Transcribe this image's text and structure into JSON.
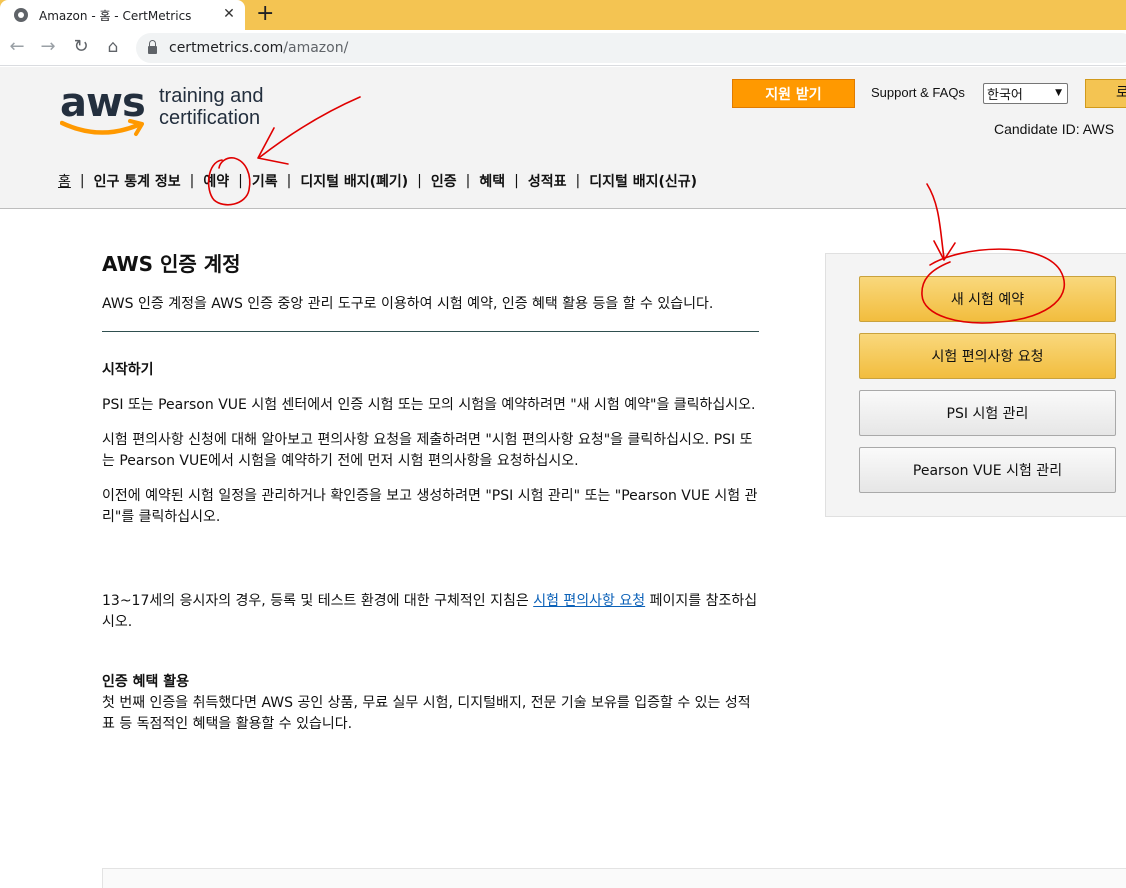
{
  "browser": {
    "tab_title": "Amazon - 홈 - CertMetrics",
    "tab_close": "✕",
    "new_tab": "+",
    "url_host": "certmetrics.com",
    "url_path": "/amazon/"
  },
  "header": {
    "logo_aws": "aws",
    "logo_line1": "training and",
    "logo_line2": "certification",
    "support_button": "지원 받기",
    "faq_link": "Support & FAQs",
    "language": "한국어",
    "login_button": "로",
    "candidate_id": "Candidate ID: AWS"
  },
  "nav": {
    "items": [
      "홈",
      "인구 통계 정보",
      "예약",
      "기록",
      "디지털 배지(폐기)",
      "인증",
      "혜택",
      "성적표",
      "디지털 배지(신규)"
    ],
    "separator": "|"
  },
  "main": {
    "title": "AWS 인증 계정",
    "intro": "AWS 인증 계정을 AWS 인증 중앙 관리 도구로 이용하여 시험 예약, 인증 혜택 활용 등을 할 수 있습니다.",
    "getting_started_title": "시작하기",
    "p1": "PSI 또는 Pearson VUE 시험 센터에서 인증 시험 또는 모의 시험을 예약하려면 \"새 시험 예약\"을 클릭하십시오.",
    "p2": "시험 편의사항 신청에 대해 알아보고 편의사항 요청을 제출하려면 \"시험 편의사항 요청\"을 클릭하십시오. PSI 또는 Pearson VUE에서 시험을 예약하기 전에 먼저 시험 편의사항을 요청하십시오.",
    "p3": "이전에 예약된 시험 일정을 관리하거나 확인증을 보고 생성하려면 \"PSI 시험 관리\" 또는 \"Pearson VUE 시험 관리\"를 클릭하십시오.",
    "minor_before": "13~17세의 응시자의 경우, 등록 및 테스트 환경에 대한 구체적인 지침은 ",
    "minor_link": "시험 편의사항 요청",
    "minor_after": " 페이지를 참조하십시오.",
    "benefits_title": "인증 혜택 활용",
    "benefits_text": "첫 번째 인증을 취득했다면 AWS 공인 상품, 무료 실무 시험, 디지털배지, 전문 기술 보유를 입증할 수 있는 성적표 등 독점적인 혜택을 활용할 수 있습니다."
  },
  "sidebar": {
    "buttons": [
      "새 시험 예약",
      "시험 편의사항 요청",
      "PSI 시험 관리",
      "Pearson VUE 시험 관리"
    ]
  },
  "colors": {
    "tabstrip": "#f4c452",
    "accent_orange": "#ff9900",
    "link": "#0b61b8",
    "annotation": "#e00000"
  }
}
